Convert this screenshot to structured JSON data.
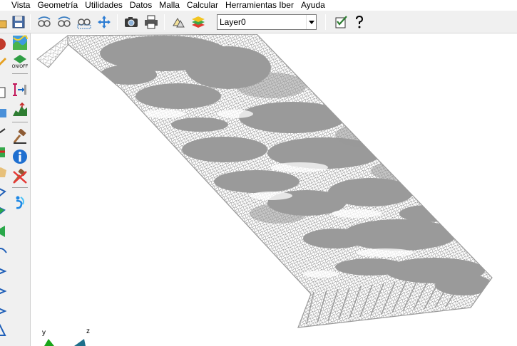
{
  "menu": {
    "items": [
      "Vista",
      "Geometría",
      "Utilidades",
      "Datos",
      "Malla",
      "Calcular",
      "Herramientas Iber",
      "Ayuda"
    ]
  },
  "toolbar": {
    "layer_value": "Layer0"
  },
  "axes": {
    "y_label": "y",
    "z_label": "z"
  },
  "colors": {
    "mesh_fill": "#9a9a9a",
    "mesh_line": "#ffffff",
    "axis_green": "#1aa51a",
    "axis_teal": "#1f6f8b"
  }
}
